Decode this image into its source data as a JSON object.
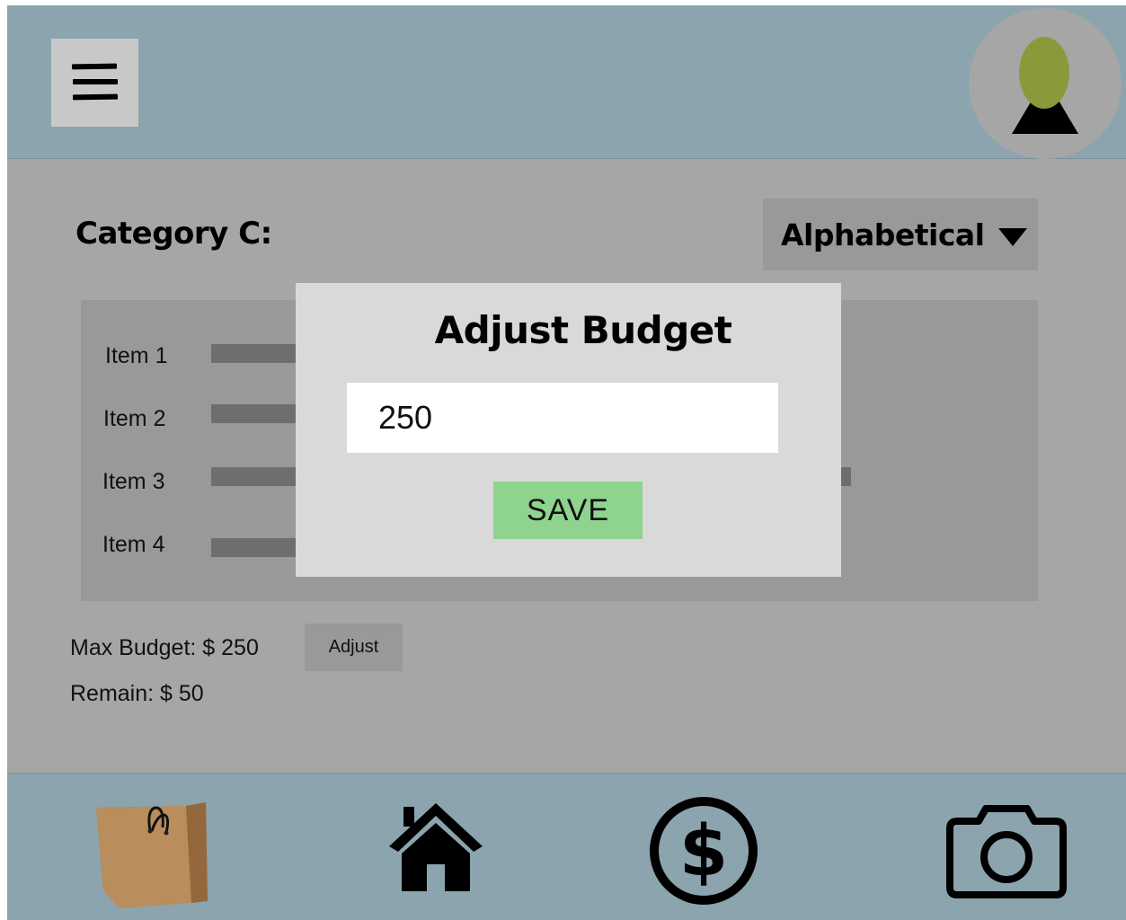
{
  "category": {
    "title": "Category C:"
  },
  "sort": {
    "label": "Alphabetical",
    "icon": "caret-down-icon"
  },
  "items": [
    {
      "label": "Item 1"
    },
    {
      "label": "Item 2"
    },
    {
      "label": "Item 3"
    },
    {
      "label": "Item 4"
    }
  ],
  "budget": {
    "max_label": "Max Budget: $ 250",
    "remain_label": "Remain: $ 50",
    "adjust_label": "Adjust"
  },
  "modal": {
    "title": "Adjust Budget",
    "input_value": "250",
    "save_label": "SAVE"
  },
  "nav": {
    "icons": [
      "shopping-bag-icon",
      "home-icon",
      "dollar-icon",
      "camera-icon"
    ]
  },
  "colors": {
    "header": "#8ca4ad",
    "background": "#a6a6a6",
    "save_button": "#8fd48e",
    "avatar_head": "#8a9a3a"
  }
}
